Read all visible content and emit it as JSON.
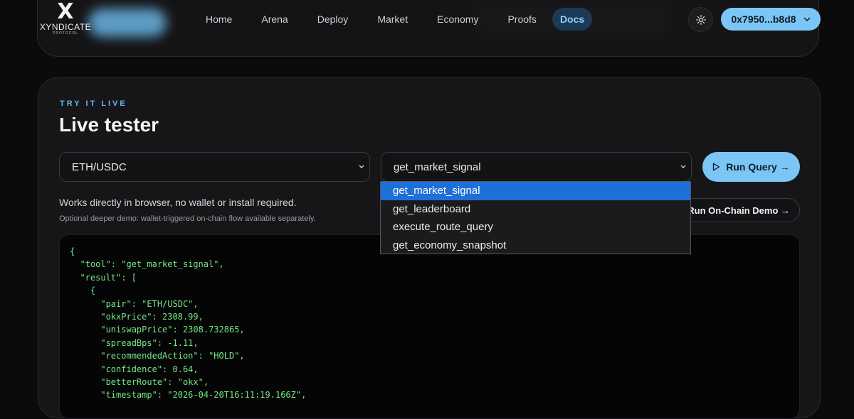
{
  "brand": {
    "name": "XYNDICATE",
    "sub": "PROTOCOL",
    "mark": "X"
  },
  "nav": {
    "items": [
      {
        "label": "Home"
      },
      {
        "label": "Arena"
      },
      {
        "label": "Deploy"
      },
      {
        "label": "Market"
      },
      {
        "label": "Economy"
      },
      {
        "label": "Proofs"
      },
      {
        "label": "Docs",
        "active": true
      }
    ],
    "wallet_label": "0x7950...b8d8"
  },
  "tester": {
    "eyebrow": "TRY IT LIVE",
    "title": "Live tester",
    "pair_select": {
      "value": "ETH/USDC"
    },
    "tool_select": {
      "value": "get_market_signal",
      "options": [
        "get_market_signal",
        "get_leaderboard",
        "execute_route_query",
        "get_economy_snapshot"
      ]
    },
    "run_label": "Run Query →",
    "note": "Works directly in browser, no wallet or install required.",
    "subnote": "Optional deeper demo: wallet-triggered on-chain flow available separately.",
    "onchain_label": "Run On-Chain Demo →",
    "code_output": "{\n  \"tool\": \"get_market_signal\",\n  \"result\": [\n    {\n      \"pair\": \"ETH/USDC\",\n      \"okxPrice\": 2308.99,\n      \"uniswapPrice\": 2308.732865,\n      \"spreadBps\": -1.11,\n      \"recommendedAction\": \"HOLD\",\n      \"confidence\": 0.64,\n      \"betterRoute\": \"okx\",\n      \"timestamp\": \"2026-04-20T16:11:19.166Z\","
  },
  "colors": {
    "accent": "#7cc6f5",
    "code_text": "#74e783",
    "selected_option": "#1f6fd8"
  }
}
